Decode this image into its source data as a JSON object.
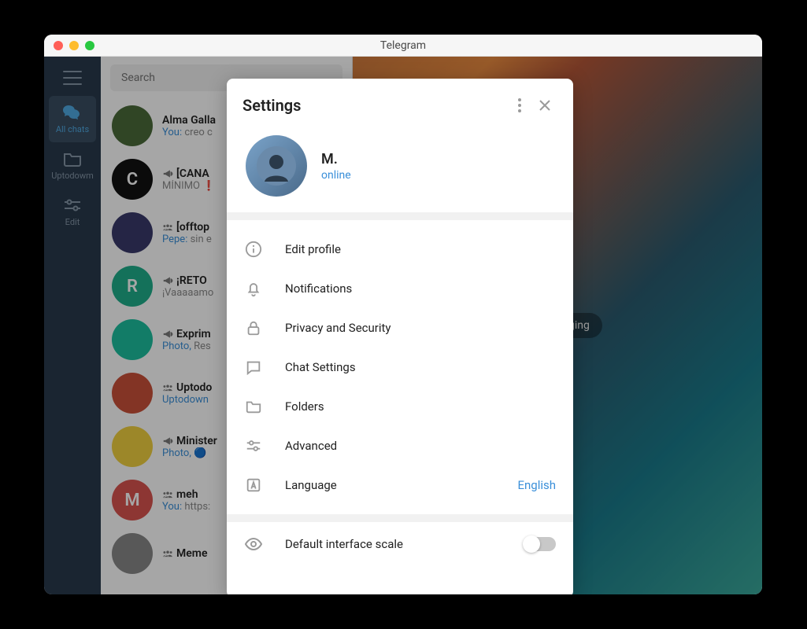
{
  "window": {
    "title": "Telegram"
  },
  "sidebar": {
    "items": [
      {
        "label": "All chats",
        "icon": "chats"
      },
      {
        "label": "Uptodowm",
        "icon": "folder"
      },
      {
        "label": "Edit",
        "icon": "sliders"
      }
    ]
  },
  "search": {
    "placeholder": "Search"
  },
  "chats": [
    {
      "title": "Alma Galla",
      "type": "person",
      "sender": "You:",
      "text": "creo c",
      "avatar_bg": "#4a6a3a"
    },
    {
      "title": "[CANA",
      "type": "channel",
      "sender": "",
      "text": "MÍNIMO ❗",
      "avatar_bg": "#111",
      "avatar_letter": "C"
    },
    {
      "title": "[offtop",
      "type": "group",
      "sender": "Pepe:",
      "text": "sin e",
      "avatar_bg": "#3a3a6a"
    },
    {
      "title": "¡RETO ",
      "type": "channel",
      "sender": "",
      "text": "¡Vaaaaamo",
      "avatar_bg": "#1fae8a",
      "avatar_letter": "R"
    },
    {
      "title": "Exprim",
      "type": "channel",
      "sender": "Photo,",
      "text": "Res",
      "avatar_bg": "#1dbf9f"
    },
    {
      "title": "Uptodo",
      "type": "group",
      "sender": "Uptodown",
      "text": "",
      "avatar_bg": "#c9503a"
    },
    {
      "title": "Minister",
      "type": "channel",
      "sender": "Photo,",
      "text": "🔵",
      "avatar_bg": "#f0d040"
    },
    {
      "title": "meh",
      "type": "group",
      "sender": "You:",
      "text": "https:",
      "avatar_bg": "#d9534f",
      "avatar_letter": "M"
    },
    {
      "title": "Meme",
      "type": "group",
      "sender": "",
      "text": "",
      "avatar_bg": "#888"
    }
  ],
  "main": {
    "placeholder": "rt messaging"
  },
  "settings": {
    "title": "Settings",
    "profile": {
      "name": "M.",
      "status": "online"
    },
    "items": [
      {
        "key": "edit-profile",
        "label": "Edit profile",
        "icon": "info"
      },
      {
        "key": "notifications",
        "label": "Notifications",
        "icon": "bell"
      },
      {
        "key": "privacy",
        "label": "Privacy and Security",
        "icon": "lock"
      },
      {
        "key": "chat-settings",
        "label": "Chat Settings",
        "icon": "chat"
      },
      {
        "key": "folders",
        "label": "Folders",
        "icon": "folder"
      },
      {
        "key": "advanced",
        "label": "Advanced",
        "icon": "sliders"
      },
      {
        "key": "language",
        "label": "Language",
        "icon": "language",
        "value": "English"
      }
    ],
    "scale": {
      "label": "Default interface scale",
      "on": false
    }
  }
}
